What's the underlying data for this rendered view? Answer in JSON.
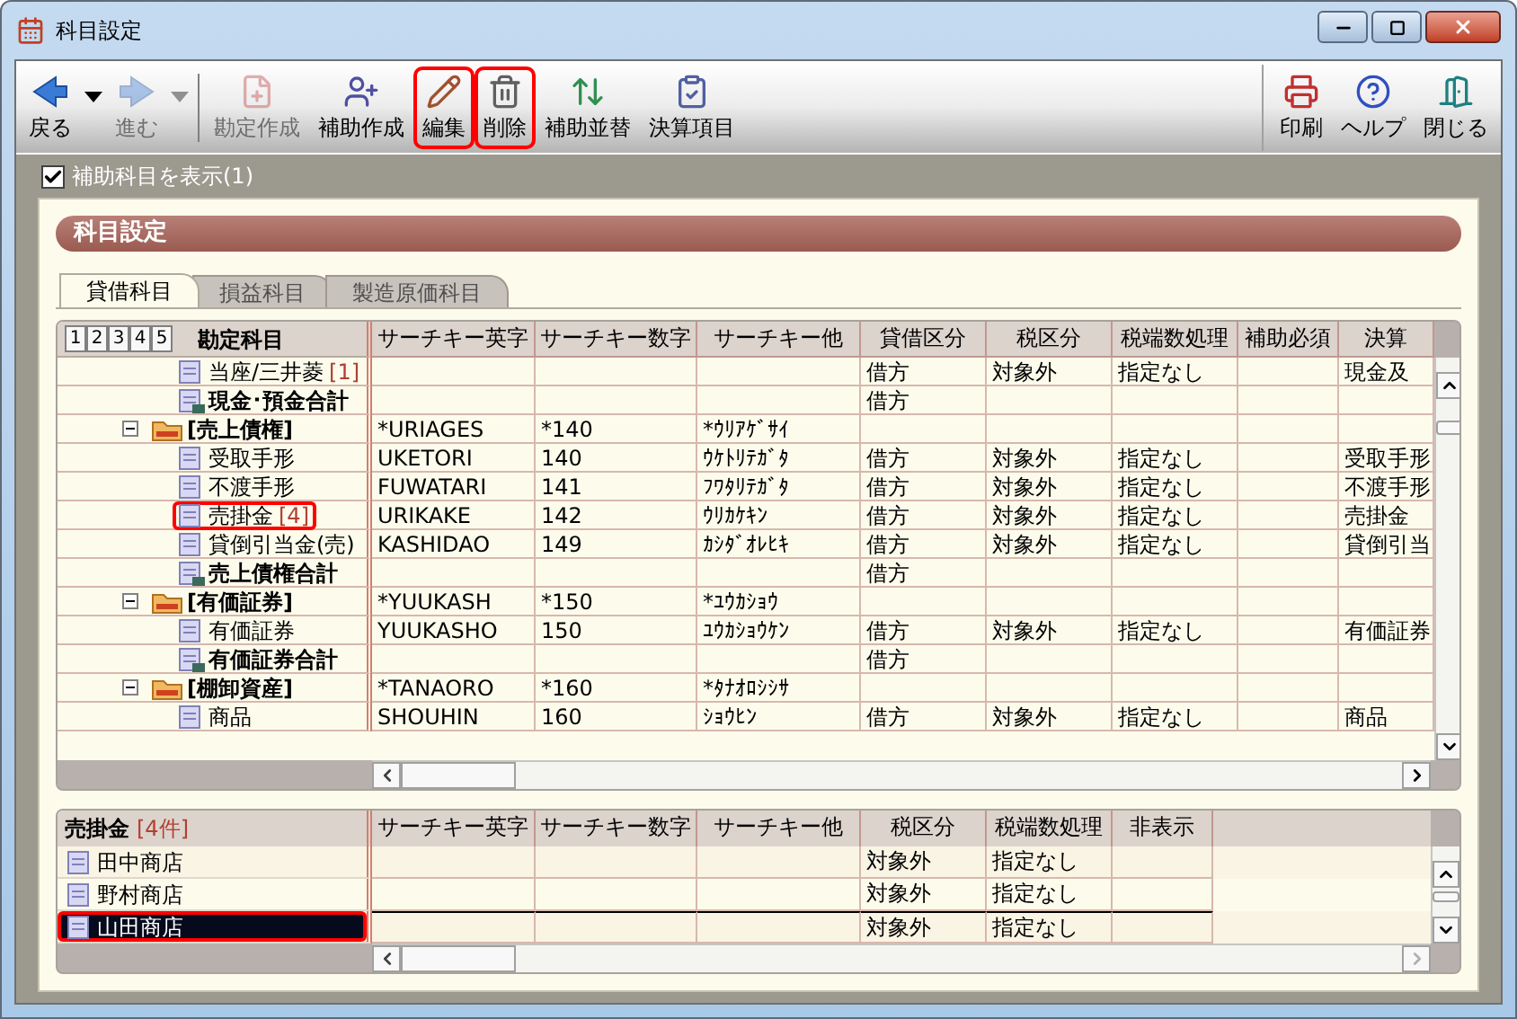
{
  "window": {
    "title": "科目設定"
  },
  "toolbar": {
    "left": [
      {
        "kind": "back",
        "label": "戻る",
        "disabled": false,
        "dropdown": true
      },
      {
        "kind": "forward",
        "label": "進む",
        "disabled": true,
        "dropdown": true
      },
      {
        "kind": "new-account",
        "label": "勘定作成",
        "disabled": true
      },
      {
        "kind": "new-sub",
        "label": "補助作成",
        "disabled": false
      },
      {
        "kind": "edit",
        "label": "編集",
        "disabled": false,
        "highlighted": true
      },
      {
        "kind": "delete",
        "label": "削除",
        "disabled": false,
        "highlighted": true
      },
      {
        "kind": "reorder",
        "label": "補助並替",
        "disabled": false
      },
      {
        "kind": "statement",
        "label": "決算項目",
        "disabled": false
      }
    ],
    "right": [
      {
        "kind": "print",
        "label": "印刷",
        "disabled": false
      },
      {
        "kind": "help",
        "label": "ヘルプ",
        "disabled": false
      },
      {
        "kind": "close",
        "label": "閉じる",
        "disabled": false
      }
    ]
  },
  "show_sub_accounts": {
    "label": "補助科目を表示(1)",
    "checked": true
  },
  "panel": {
    "title": "科目設定"
  },
  "tabs": [
    {
      "label": "貸借科目",
      "selected": true
    },
    {
      "label": "損益科目",
      "selected": false
    },
    {
      "label": "製造原価科目",
      "selected": false
    }
  ],
  "account_grid": {
    "level_buttons": [
      "1",
      "2",
      "3",
      "4",
      "5"
    ],
    "columns": [
      "勘定科目",
      "サーチキー英字",
      "サーチキー数字",
      "サーチキー他",
      "貸借区分",
      "税区分",
      "税端数処理",
      "補助必須",
      "決算"
    ],
    "rows": [
      {
        "kind": "account",
        "name": "当座/三井菱",
        "count": "[1]",
        "balance_side": "借方",
        "tax": "対象外",
        "rounding": "指定なし",
        "statement": "現金及"
      },
      {
        "kind": "total",
        "name": "現金･預金合計",
        "balance_side": "借方"
      },
      {
        "kind": "group",
        "name": "[売上債権]",
        "expanded": true,
        "search_alpha": "*URIAGES",
        "search_num": "*140",
        "search_other": "*ｳﾘｱｹﾞｻｲ",
        "children": [
          {
            "kind": "account",
            "name": "受取手形",
            "search_alpha": "UKETORI",
            "search_num": "140",
            "search_other": "ｳｹﾄﾘﾃｶﾞﾀ",
            "balance_side": "借方",
            "tax": "対象外",
            "rounding": "指定なし",
            "statement": "受取手形"
          },
          {
            "kind": "account",
            "name": "不渡手形",
            "search_alpha": "FUWATARI",
            "search_num": "141",
            "search_other": "ﾌﾜﾀﾘﾃｶﾞﾀ",
            "balance_side": "借方",
            "tax": "対象外",
            "rounding": "指定なし",
            "statement": "不渡手形"
          },
          {
            "kind": "account",
            "name": "売掛金",
            "count": "[4]",
            "highlighted": true,
            "search_alpha": "URIKAKE",
            "search_num": "142",
            "search_other": "ｳﾘｶｹｷﾝ",
            "balance_side": "借方",
            "tax": "対象外",
            "rounding": "指定なし",
            "statement": "売掛金"
          },
          {
            "kind": "account",
            "name": "貸倒引当金(売)",
            "search_alpha": "KASHIDAO",
            "search_num": "149",
            "search_other": "ｶｼﾀﾞｵﾚﾋｷ",
            "balance_side": "借方",
            "tax": "対象外",
            "rounding": "指定なし",
            "statement": "貸倒引当"
          }
        ]
      },
      {
        "kind": "total",
        "name": "売上債権合計",
        "balance_side": "借方"
      },
      {
        "kind": "group",
        "name": "[有価証券]",
        "expanded": true,
        "search_alpha": "*YUUKASH",
        "search_num": "*150",
        "search_other": "*ﾕｳｶｼｮｳ",
        "children": [
          {
            "kind": "account",
            "name": "有価証券",
            "search_alpha": "YUUKASHO",
            "search_num": "150",
            "search_other": "ﾕｳｶｼｮｳｹﾝ",
            "balance_side": "借方",
            "tax": "対象外",
            "rounding": "指定なし",
            "statement": "有価証券"
          }
        ]
      },
      {
        "kind": "total",
        "name": "有価証券合計",
        "balance_side": "借方"
      },
      {
        "kind": "group",
        "name": "[棚卸資産]",
        "expanded": true,
        "search_alpha": "*TANAORO",
        "search_num": "*160",
        "search_other": "*ﾀﾅｵﾛｼｼｻ",
        "children": [
          {
            "kind": "account",
            "name": "商品",
            "search_alpha": "SHOUHIN",
            "search_num": "160",
            "search_other": "ｼｮｳﾋﾝ",
            "balance_side": "借方",
            "tax": "対象外",
            "rounding": "指定なし",
            "statement": "商品"
          }
        ]
      }
    ]
  },
  "sub_grid": {
    "title": "売掛金",
    "count": "[4件]",
    "columns": [
      "サーチキー英字",
      "サーチキー数字",
      "サーチキー他",
      "税区分",
      "税端数処理",
      "非表示"
    ],
    "rows": [
      {
        "name": "田中商店",
        "selected": false,
        "tax": "対象外",
        "rounding": "指定なし"
      },
      {
        "name": "野村商店",
        "selected": false,
        "tax": "対象外",
        "rounding": "指定なし"
      },
      {
        "name": "山田商店",
        "selected": true,
        "highlighted": true,
        "tax": "対象外",
        "rounding": "指定なし"
      }
    ]
  }
}
